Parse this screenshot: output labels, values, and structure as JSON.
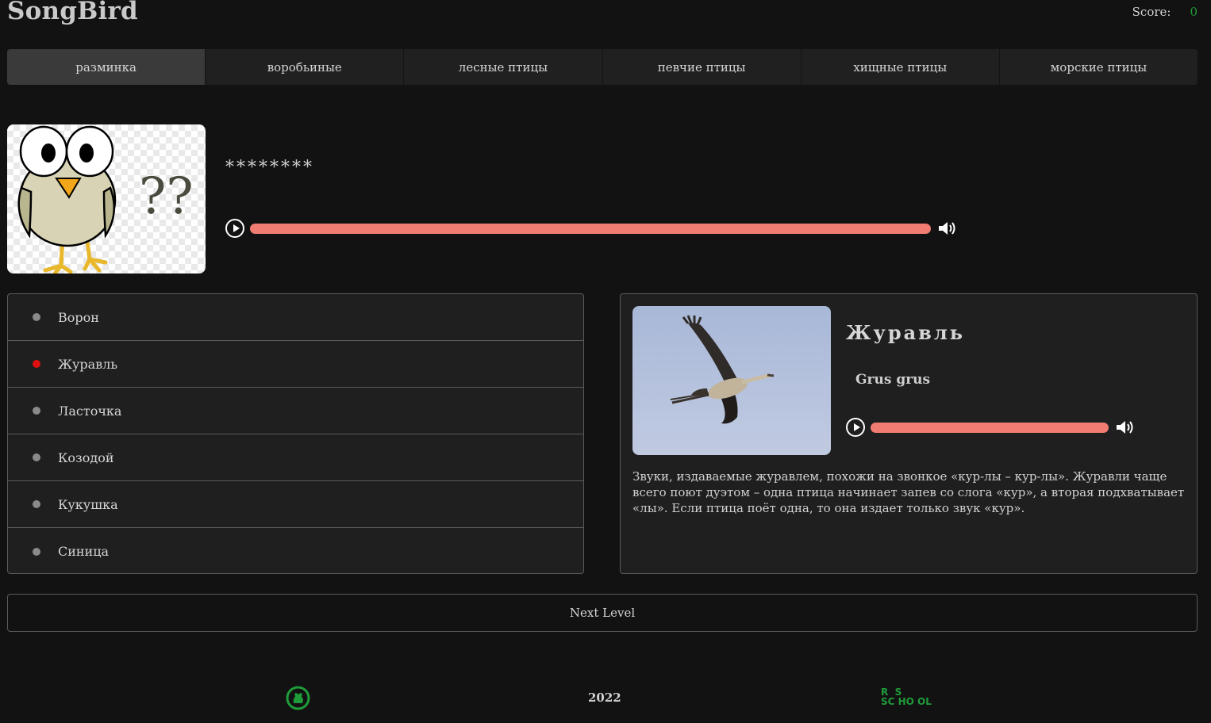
{
  "header": {
    "logo": "SongBird",
    "score_label": "Score:",
    "score_value": "0"
  },
  "tabs": [
    {
      "label": "разминка",
      "active": true
    },
    {
      "label": "воробьиные",
      "active": false
    },
    {
      "label": "лесные птицы",
      "active": false
    },
    {
      "label": "певчие птицы",
      "active": false
    },
    {
      "label": "хищные птицы",
      "active": false
    },
    {
      "label": "морские птицы",
      "active": false
    }
  ],
  "question": {
    "hidden_name": "********",
    "image_icon": "owl-question-icon",
    "question_marks": "??",
    "player_progress": 1.0
  },
  "answers": [
    {
      "label": "Ворон",
      "state": "neutral"
    },
    {
      "label": "Журавль",
      "state": "wrong"
    },
    {
      "label": "Ласточка",
      "state": "neutral"
    },
    {
      "label": "Козодой",
      "state": "neutral"
    },
    {
      "label": "Кукушка",
      "state": "neutral"
    },
    {
      "label": "Синица",
      "state": "neutral"
    }
  ],
  "details": {
    "name": "Журавль",
    "latin": "Grus grus",
    "description": "Звуки, издаваемые журавлем, похожи на звонкое «кур-лы – кур-лы». Журавли чаще всего поют дуэтом – одна птица начинает запев со слога «кур», а вторая подхватывает «лы». Если птица поёт одна, то она издает только звук «кур».",
    "player_progress": 1.0
  },
  "next_button": "Next Level",
  "footer": {
    "year": "2022",
    "github_icon": "github-icon",
    "rss_logo_line1": "R  S",
    "rss_logo_line2": "SC HO OL"
  },
  "colors": {
    "background": "#121212",
    "panel": "#1f1f1f",
    "accent_track": "#f07c72",
    "score_green": "#1f9c3a",
    "wrong_dot": "#e01010",
    "neutral_dot": "#8a8a8a"
  }
}
